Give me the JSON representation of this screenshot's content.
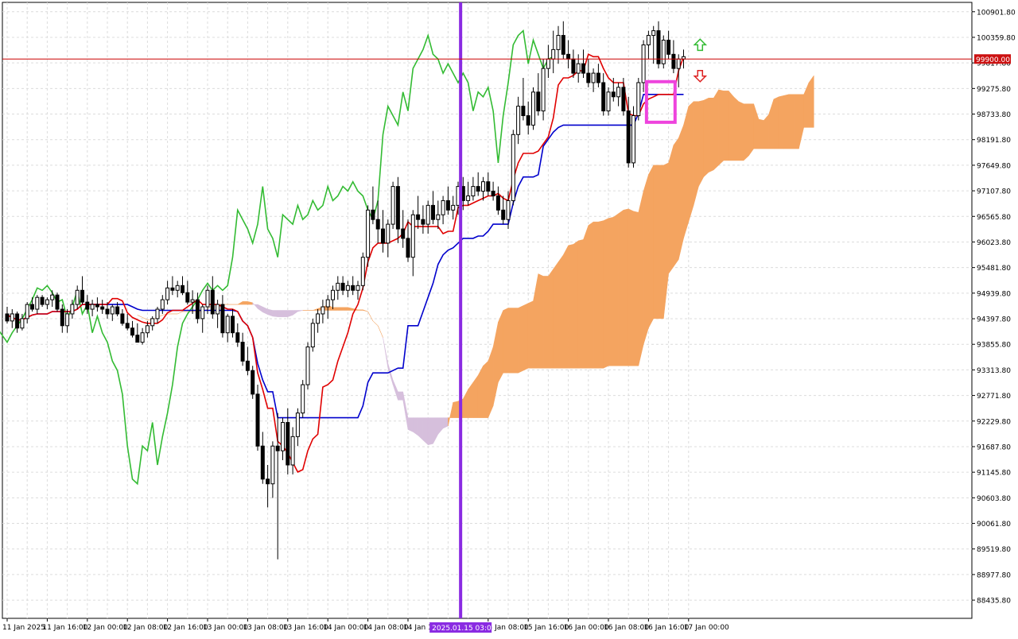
{
  "chart_data": {
    "type": "candlestick",
    "indicator": "Ichimoku Kinko Hyo",
    "y_ticks": [
      100901.8,
      100359.8,
      99817.8,
      99275.8,
      98733.8,
      98191.8,
      97649.8,
      97107.8,
      96565.8,
      96023.8,
      95481.8,
      94939.8,
      94397.8,
      93855.8,
      93313.8,
      92771.8,
      92229.8,
      91687.8,
      91145.8,
      90603.8,
      90061.8,
      89519.8,
      88977.8,
      88435.8
    ],
    "y_tick_labels": [
      "100901.80",
      "100359.80",
      "99817.80",
      "99275.80",
      "98733.80",
      "98191.80",
      "97649.80",
      "97107.80",
      "96565.80",
      "96023.80",
      "95481.80",
      "94939.80",
      "94397.80",
      "93855.80",
      "93313.80",
      "92771.80",
      "92229.80",
      "91687.80",
      "91145.80",
      "90603.80",
      "90061.80",
      "89519.80",
      "88977.80",
      "88435.80"
    ],
    "x_tick_labels": [
      "11 Jan 2025",
      "11 Jan 16:00",
      "12 Jan 00:00",
      "12 Jan 08:00",
      "12 Jan 16:00",
      "13 Jan 00:00",
      "13 Jan 08:00",
      "13 Jan 16:00",
      "14 Jan 00:00",
      "14 Jan 08:00",
      "14 Jan 16:00",
      "15 Jan 08:00",
      "15 Jan 16:00",
      "16 Jan 00:00",
      "16 Jan 08:00",
      "16 Jan 16:00",
      "17 Jan 00:00"
    ],
    "x_tick_bar_index": [
      0,
      8,
      16,
      24,
      32,
      40,
      48,
      56,
      64,
      72,
      80,
      96,
      104,
      112,
      120,
      128,
      136
    ],
    "ylim": [
      88050,
      101100
    ],
    "bar_count": 136,
    "current_price": 99900.0,
    "current_price_label": "99900.00",
    "marker_label": "2025.01.15 03:00",
    "marker_bar_index": 90.5,
    "colors": {
      "bull": "#000000",
      "bear": "#000000",
      "bear_fill": "#000000",
      "tenkan": "#e00000",
      "kijun": "#0000cc",
      "chikou": "#33bb33",
      "senkou_bull": "#f4a460",
      "senkou_bear": "#d6bfdc",
      "marker": "#8a2be2",
      "price_line": "#cc0000",
      "highlight": "#ee44dd",
      "arrow_up": "#33bb33",
      "arrow_down": "#dd2222"
    },
    "candles": [
      [
        94500,
        94650,
        94300,
        94350
      ],
      [
        94350,
        94600,
        94200,
        94500
      ],
      [
        94500,
        94550,
        94100,
        94200
      ],
      [
        94200,
        94500,
        94150,
        94400
      ],
      [
        94400,
        94750,
        94300,
        94700
      ],
      [
        94700,
        94850,
        94550,
        94600
      ],
      [
        94600,
        94900,
        94500,
        94850
      ],
      [
        94850,
        94900,
        94650,
        94700
      ],
      [
        94700,
        94850,
        94600,
        94800
      ],
      [
        94800,
        95000,
        94650,
        94900
      ],
      [
        94900,
        94950,
        94550,
        94600
      ],
      [
        94600,
        94700,
        94100,
        94250
      ],
      [
        94250,
        94600,
        94100,
        94500
      ],
      [
        94500,
        94800,
        94400,
        94700
      ],
      [
        94700,
        95100,
        94600,
        95000
      ],
      [
        95000,
        95300,
        94700,
        94750
      ],
      [
        94750,
        94900,
        94500,
        94600
      ],
      [
        94600,
        94800,
        94450,
        94700
      ],
      [
        94700,
        94850,
        94550,
        94650
      ],
      [
        94650,
        94800,
        94500,
        94600
      ],
      [
        94600,
        94750,
        94400,
        94500
      ],
      [
        94500,
        94700,
        94350,
        94650
      ],
      [
        94650,
        94750,
        94450,
        94500
      ],
      [
        94500,
        94600,
        94250,
        94300
      ],
      [
        94300,
        94500,
        94150,
        94200
      ],
      [
        94200,
        94350,
        94000,
        94050
      ],
      [
        94050,
        94300,
        93900,
        93900
      ],
      [
        93900,
        94200,
        93850,
        94100
      ],
      [
        94100,
        94350,
        94000,
        94250
      ],
      [
        94250,
        94450,
        94150,
        94400
      ],
      [
        94400,
        94650,
        94300,
        94600
      ],
      [
        94600,
        94900,
        94500,
        94800
      ],
      [
        94800,
        95200,
        94700,
        95050
      ],
      [
        95050,
        95300,
        94900,
        95000
      ],
      [
        95000,
        95200,
        94850,
        95100
      ],
      [
        95100,
        95300,
        94900,
        94950
      ],
      [
        94950,
        95200,
        94700,
        94750
      ],
      [
        94750,
        95000,
        94500,
        94800
      ],
      [
        94800,
        94950,
        94300,
        94400
      ],
      [
        94400,
        94700,
        94100,
        94650
      ],
      [
        94650,
        95100,
        94500,
        95000
      ],
      [
        95000,
        95300,
        94400,
        94500
      ],
      [
        94500,
        94800,
        94200,
        94700
      ],
      [
        94700,
        94900,
        94000,
        94100
      ],
      [
        94100,
        94500,
        93900,
        94450
      ],
      [
        94450,
        94600,
        94000,
        94100
      ],
      [
        94100,
        94300,
        93800,
        93900
      ],
      [
        93900,
        94100,
        93400,
        93500
      ],
      [
        93500,
        93800,
        93200,
        93300
      ],
      [
        93300,
        93400,
        92700,
        92800
      ],
      [
        92800,
        93000,
        91600,
        91700
      ],
      [
        91700,
        92000,
        90900,
        91000
      ],
      [
        91000,
        91300,
        90400,
        90900
      ],
      [
        90900,
        91800,
        90600,
        91700
      ],
      [
        91700,
        92400,
        89300,
        91600
      ],
      [
        91600,
        92300,
        91400,
        92200
      ],
      [
        92200,
        92500,
        91100,
        91300
      ],
      [
        91300,
        92100,
        91100,
        91900
      ],
      [
        91900,
        92500,
        91700,
        92400
      ],
      [
        92400,
        93100,
        92300,
        93000
      ],
      [
        93000,
        93900,
        92900,
        93800
      ],
      [
        93800,
        94400,
        93700,
        94300
      ],
      [
        94300,
        94600,
        94100,
        94500
      ],
      [
        94500,
        94800,
        94300,
        94650
      ],
      [
        94650,
        94900,
        94400,
        94800
      ],
      [
        94800,
        95100,
        94600,
        95000
      ],
      [
        95000,
        95300,
        94800,
        95150
      ],
      [
        95150,
        95300,
        94900,
        95000
      ],
      [
        95000,
        95200,
        94850,
        95100
      ],
      [
        95100,
        95300,
        94900,
        95000
      ],
      [
        95000,
        95200,
        94800,
        95100
      ],
      [
        95100,
        95800,
        95000,
        95700
      ],
      [
        95700,
        96800,
        95500,
        96700
      ],
      [
        96700,
        97200,
        96400,
        96500
      ],
      [
        96500,
        96900,
        96000,
        96300
      ],
      [
        96300,
        96700,
        95800,
        96000
      ],
      [
        96000,
        96500,
        95700,
        96400
      ],
      [
        96400,
        97300,
        96300,
        97200
      ],
      [
        97200,
        97400,
        96000,
        96300
      ],
      [
        96300,
        96700,
        95900,
        96100
      ],
      [
        96100,
        96500,
        95600,
        95700
      ],
      [
        95700,
        96700,
        95300,
        96600
      ],
      [
        96600,
        97000,
        96300,
        96500
      ],
      [
        96500,
        96800,
        96200,
        96400
      ],
      [
        96400,
        96900,
        96200,
        96800
      ],
      [
        96800,
        97100,
        96400,
        96500
      ],
      [
        96500,
        96900,
        96300,
        96600
      ],
      [
        96600,
        97000,
        96400,
        96900
      ],
      [
        96900,
        97200,
        96600,
        96700
      ],
      [
        96700,
        97000,
        96500,
        96800
      ],
      [
        96800,
        97300,
        96600,
        97200
      ],
      [
        97200,
        97400,
        96700,
        96900
      ],
      [
        96900,
        97300,
        96800,
        97000
      ],
      [
        97000,
        97400,
        96900,
        97200
      ],
      [
        97200,
        97500,
        97000,
        97100
      ],
      [
        97100,
        97400,
        96900,
        97300
      ],
      [
        97300,
        97500,
        97000,
        97100
      ],
      [
        97100,
        97300,
        96900,
        97000
      ],
      [
        97000,
        97200,
        96600,
        96700
      ],
      [
        96700,
        97000,
        96400,
        96500
      ],
      [
        96500,
        97100,
        96300,
        96900
      ],
      [
        96900,
        98400,
        96800,
        98300
      ],
      [
        98300,
        99100,
        98100,
        98900
      ],
      [
        98900,
        99500,
        98600,
        98700
      ],
      [
        98700,
        99000,
        98300,
        98500
      ],
      [
        98500,
        99300,
        98400,
        99200
      ],
      [
        99200,
        99600,
        98700,
        98800
      ],
      [
        98800,
        99900,
        98600,
        99700
      ],
      [
        99700,
        100200,
        99500,
        99900
      ],
      [
        99900,
        100500,
        99600,
        100100
      ],
      [
        100100,
        100600,
        99800,
        100400
      ],
      [
        100400,
        100700,
        99900,
        100000
      ],
      [
        100000,
        100300,
        99700,
        99900
      ],
      [
        99900,
        100100,
        99500,
        99600
      ],
      [
        99600,
        100000,
        99400,
        99800
      ],
      [
        99800,
        100100,
        99500,
        99600
      ],
      [
        99600,
        99900,
        99300,
        99400
      ],
      [
        99400,
        99700,
        99200,
        99600
      ],
      [
        99600,
        99800,
        99300,
        99400
      ],
      [
        99400,
        99600,
        98700,
        98800
      ],
      [
        98800,
        99300,
        98700,
        99200
      ],
      [
        99200,
        99500,
        99000,
        99100
      ],
      [
        99100,
        99400,
        98900,
        99300
      ],
      [
        99300,
        99500,
        98700,
        98800
      ],
      [
        98800,
        99100,
        97600,
        97700
      ],
      [
        97700,
        98900,
        97600,
        98700
      ],
      [
        98700,
        99500,
        98600,
        99400
      ],
      [
        99400,
        100300,
        99200,
        100200
      ],
      [
        100200,
        100500,
        99900,
        100400
      ],
      [
        100400,
        100600,
        99800,
        100500
      ],
      [
        100500,
        100700,
        99700,
        99800
      ],
      [
        99800,
        100400,
        99700,
        100300
      ],
      [
        100300,
        100500,
        99900,
        100000
      ],
      [
        100000,
        100300,
        99600,
        99700
      ],
      [
        99700,
        100000,
        99300,
        99900
      ],
      [
        99900,
        100100,
        99700,
        99950
      ]
    ]
  }
}
